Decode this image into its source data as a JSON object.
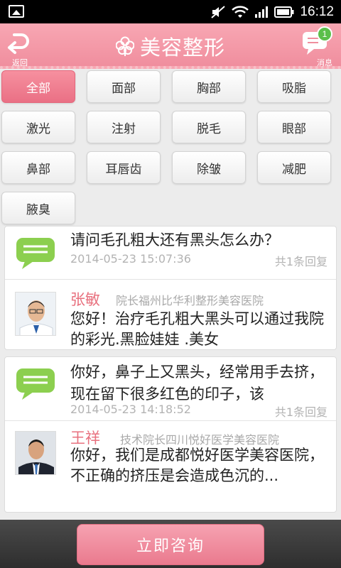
{
  "status_bar": {
    "time": "16:12",
    "icons": [
      "image-icon",
      "mute-icon",
      "wifi-icon",
      "signal-icon",
      "battery-icon"
    ]
  },
  "header": {
    "back_label": "返回",
    "title": "美容整形",
    "messages_label": "消息",
    "messages_badge": "1",
    "accent_color": "#f08e9e"
  },
  "categories": [
    {
      "label": "全部",
      "active": true
    },
    {
      "label": "面部",
      "active": false
    },
    {
      "label": "胸部",
      "active": false
    },
    {
      "label": "吸脂",
      "active": false
    },
    {
      "label": "激光",
      "active": false
    },
    {
      "label": "注射",
      "active": false
    },
    {
      "label": "脱毛",
      "active": false
    },
    {
      "label": "眼部",
      "active": false
    },
    {
      "label": "鼻部",
      "active": false
    },
    {
      "label": "耳唇齿",
      "active": false
    },
    {
      "label": "除皱",
      "active": false
    },
    {
      "label": "减肥",
      "active": false
    },
    {
      "label": "腋臭",
      "active": false
    }
  ],
  "questions": [
    {
      "title": "请问毛孔粗大还有黑头怎么办？",
      "date": "2014-05-23 15:07:36",
      "replies": "共1条回复",
      "doctor_name": "张敏",
      "doctor_title": "院长福州比华利整形美容医院",
      "answer": "您好！治疗毛孔粗大黑头可以通过我院的彩光.黑脸娃娃 .美女"
    },
    {
      "title": "你好，鼻子上又黑头，经常用手去挤，现在留下很多红色的印子，该",
      "date": "2014-05-23 14:18:52",
      "replies": "共1条回复",
      "doctor_name": "王祥",
      "doctor_title": "技术院长四川悦好医学美容医院",
      "answer": "你好，我们是成都悦好医学美容医院，不正确的挤压是会造成色沉的..."
    }
  ],
  "bottom": {
    "consult_label": "立即咨询"
  }
}
